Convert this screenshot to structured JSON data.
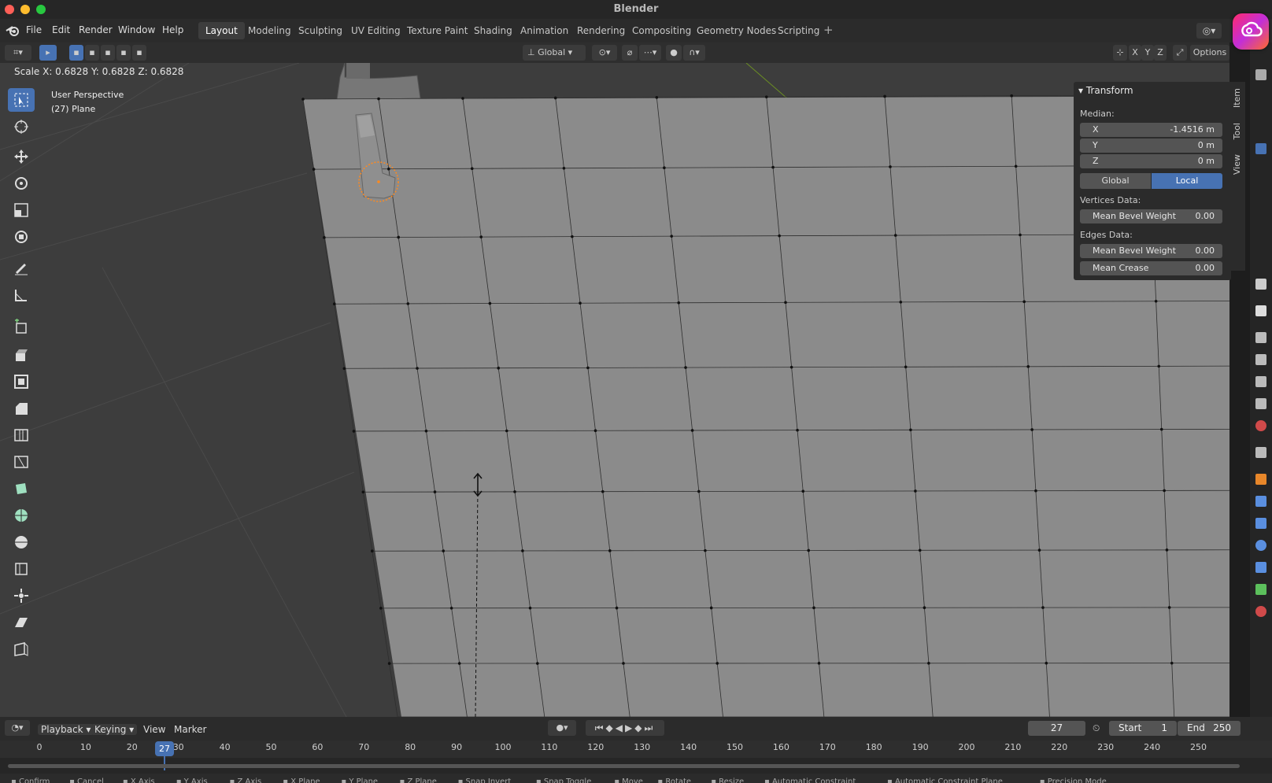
{
  "app": {
    "title": "Blender"
  },
  "menus": [
    "File",
    "Edit",
    "Render",
    "Window",
    "Help"
  ],
  "workspaces": {
    "tabs": [
      "Layout",
      "Modeling",
      "Sculpting",
      "UV Editing",
      "Texture Paint",
      "Shading",
      "Animation",
      "Rendering",
      "Compositing",
      "Geometry Nodes",
      "Scripting"
    ],
    "active": "Layout",
    "add_symbol": "+"
  },
  "header": {
    "orientation": "Global",
    "axes": [
      "X",
      "Y",
      "Z"
    ],
    "options_label": "Options"
  },
  "viewport": {
    "operator_status": "Scale X: 0.6828   Y: 0.6828  Z: 0.6828",
    "view_name": "User Perspective",
    "object_label": "(27) Plane"
  },
  "npanel": {
    "title": "Transform",
    "median_label": "Median:",
    "fields": [
      {
        "label": "X",
        "value": "-1.4516 m"
      },
      {
        "label": "Y",
        "value": "0 m"
      },
      {
        "label": "Z",
        "value": "0 m"
      }
    ],
    "global_label": "Global",
    "local_label": "Local",
    "space_active": "Local",
    "vertices_label": "Vertices Data:",
    "vertex_bevel": {
      "label": "Mean Bevel Weight",
      "value": "0.00"
    },
    "edges_label": "Edges Data:",
    "edge_bevel": {
      "label": "Mean Bevel Weight",
      "value": "0.00"
    },
    "edge_crease": {
      "label": "Mean Crease",
      "value": "0.00"
    },
    "side_tabs": [
      "Item",
      "Tool",
      "View"
    ]
  },
  "tools": [
    "select-box",
    "cursor",
    "move",
    "rotate",
    "scale",
    "transform",
    "annotate",
    "measure",
    "add-cube",
    "extrude",
    "inset",
    "bevel",
    "loop-cut",
    "knife",
    "poly-build",
    "spin",
    "smooth",
    "edge-slide",
    "shrink-fatten",
    "shear",
    "rip-region"
  ],
  "timeline": {
    "menus": [
      "Playback",
      "Keying",
      "View",
      "Marker"
    ],
    "current_frame": "27",
    "start_label": "Start",
    "start_value": "1",
    "end_label": "End",
    "end_value": "250",
    "ticks": [
      "0",
      "10",
      "20",
      "30",
      "40",
      "50",
      "60",
      "70",
      "80",
      "90",
      "100",
      "110",
      "120",
      "130",
      "140",
      "150",
      "160",
      "170",
      "180",
      "190",
      "200",
      "210",
      "220",
      "230",
      "240",
      "250"
    ]
  },
  "statusbar": [
    "Confirm",
    "Cancel",
    "X Axis",
    "Y Axis",
    "Z Axis",
    "X Plane",
    "Y Plane",
    "Z Plane",
    "Snap Invert",
    "Snap Toggle",
    "Move",
    "Rotate",
    "Resize",
    "Automatic Constraint",
    "Automatic Constraint Plane",
    "Precision Mode"
  ],
  "colors": {
    "accent": "#4772b3",
    "mesh": "#8b8b8b",
    "selection": "#ff8a1f"
  }
}
